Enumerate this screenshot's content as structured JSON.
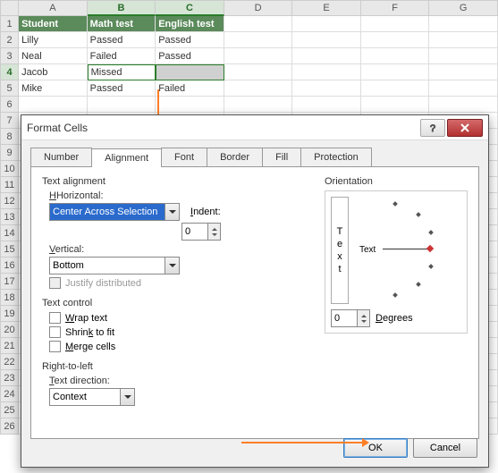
{
  "sheet": {
    "cols": [
      "A",
      "B",
      "C",
      "D",
      "E",
      "F",
      "G"
    ],
    "rows": [
      "1",
      "2",
      "3",
      "4",
      "5",
      "6",
      "7",
      "8",
      "9",
      "10",
      "11",
      "12",
      "13",
      "14",
      "15",
      "16",
      "17",
      "18",
      "19",
      "20",
      "21",
      "22",
      "23",
      "24",
      "25",
      "26"
    ],
    "selected_cols": [
      "B",
      "C"
    ],
    "selected_row": "4",
    "headers": [
      "Student",
      "Math test",
      "English test"
    ],
    "data": [
      [
        "Lilly",
        "Passed",
        "Passed"
      ],
      [
        "Neal",
        "Failed",
        "Passed"
      ],
      [
        "Jacob",
        "Missed",
        ""
      ],
      [
        "Mike",
        "Passed",
        "Failed"
      ]
    ]
  },
  "dialog": {
    "title": "Format Cells",
    "tabs": [
      "Number",
      "Alignment",
      "Font",
      "Border",
      "Fill",
      "Protection"
    ],
    "active_tab": "Alignment",
    "text_alignment": {
      "group": "Text alignment",
      "horizontal_label": "Horizontal:",
      "horizontal_value": "Center Across Selection",
      "indent_label": "Indent:",
      "indent_value": "0",
      "vertical_label": "Vertical:",
      "vertical_value": "Bottom",
      "justify_label": "Justify distributed"
    },
    "text_control": {
      "group": "Text control",
      "wrap": "Wrap text",
      "shrink": "Shrink to fit",
      "merge": "Merge cells"
    },
    "rtl": {
      "group": "Right-to-left",
      "direction_label": "Text direction:",
      "direction_value": "Context"
    },
    "orientation": {
      "group": "Orientation",
      "vertical_text": [
        "T",
        "e",
        "x",
        "t"
      ],
      "dial_text": "Text",
      "degrees_value": "0",
      "degrees_label": "Degrees"
    },
    "ok": "OK",
    "cancel": "Cancel"
  }
}
